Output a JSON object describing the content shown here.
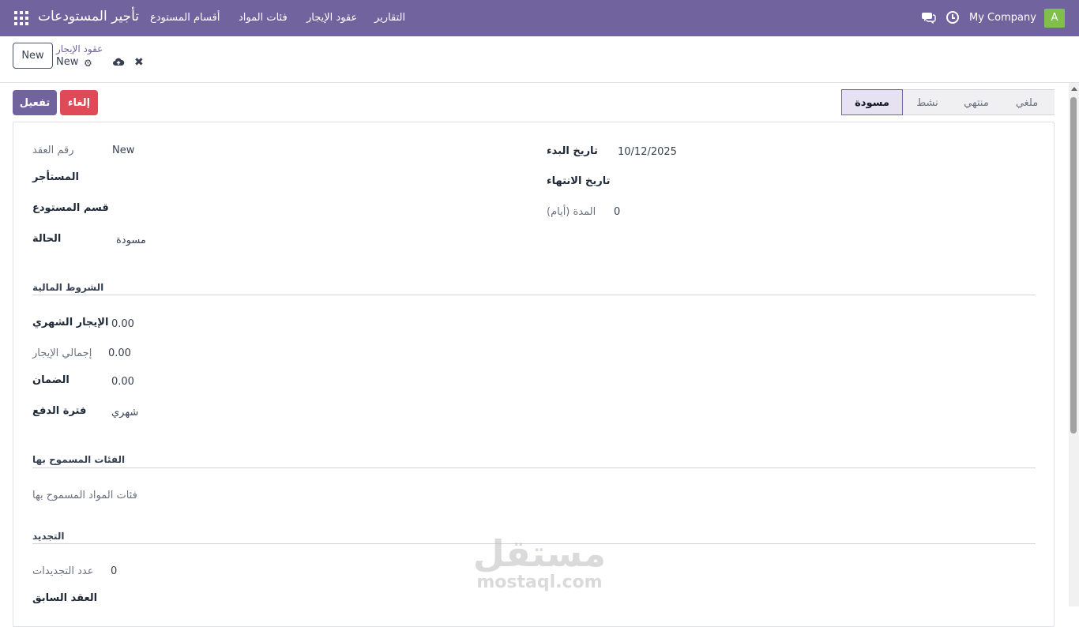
{
  "navbar": {
    "brand": "تأجير المستودعات",
    "menu": [
      "أقسام المستودع",
      "فئات المواد",
      "عقود الإيجار",
      "التقارير"
    ],
    "company": "My Company",
    "avatar": "A"
  },
  "control": {
    "new_label": "New",
    "breadcrumb_parent": "عقود الإيجار",
    "record_name": "New"
  },
  "actions": {
    "activate": "تفعيل",
    "cancel": "إلغاء"
  },
  "statusbar": {
    "stages": [
      "مسودة",
      "نشط",
      "منتهي",
      "ملغي"
    ],
    "active": "مسودة"
  },
  "form": {
    "contract_number_label": "رقم العقد",
    "contract_number_value": "New",
    "tenant_label": "المستأجر",
    "section_label": "قسم المستودع",
    "state_label": "الحالة",
    "state_value": "مسودة",
    "start_date_label": "تاريخ البدء",
    "start_date_value": "10/12/2025",
    "end_date_label": "تاريخ الانتهاء",
    "duration_label": "المدة (أيام)",
    "duration_value": "0"
  },
  "financial": {
    "title": "الشروط المالية",
    "monthly_rent_label": "الإيجار الشهري",
    "monthly_rent_value": "0.00",
    "total_rent_label": "إجمالي الإيجار",
    "total_rent_value": "0.00",
    "deposit_label": "الضمان",
    "deposit_value": "0.00",
    "payment_period_label": "فترة الدفع",
    "payment_period_value": "شهري"
  },
  "categories": {
    "title": "الفئات المسموح بها",
    "placeholder": "فئات المواد المسموح بها"
  },
  "renewal": {
    "title": "التجديد",
    "count_label": "عدد التجديدات",
    "count_value": "0",
    "previous_label": "العقد السابق"
  },
  "watermark": {
    "arabic": "مستقل",
    "latin": "mostaql.com"
  }
}
